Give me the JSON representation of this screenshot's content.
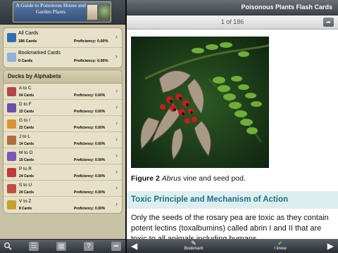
{
  "sidebar": {
    "logo_text": "A Guide to Poisonous House and Garden Plants",
    "summary": [
      {
        "title": "All Cards",
        "count": "186 Cards",
        "proficiency": "Proficiency: 0.00%",
        "color": "#2f6fb0"
      },
      {
        "title": "Bookmarked Cards",
        "count": "0 Cards",
        "proficiency": "Proficiency: 0.00%",
        "color": "#8fb3d8"
      }
    ],
    "decks_header": "Decks by Alphabets",
    "decks": [
      {
        "title": "A to C",
        "count": "64 Cards",
        "proficiency": "Proficiency: 0.00%",
        "color": "#b2454a"
      },
      {
        "title": "D to F",
        "count": "15 Cards",
        "proficiency": "Proficiency: 0.00%",
        "color": "#6b4fa8"
      },
      {
        "title": "G to I",
        "count": "22 Cards",
        "proficiency": "Proficiency: 0.00%",
        "color": "#d99430"
      },
      {
        "title": "J to L",
        "count": "14 Cards",
        "proficiency": "Proficiency: 0.00%",
        "color": "#b36a40"
      },
      {
        "title": "M to O",
        "count": "15 Cards",
        "proficiency": "Proficiency: 0.00%",
        "color": "#7a58b8"
      },
      {
        "title": "P to R",
        "count": "24 Cards",
        "proficiency": "Proficiency: 0.00%",
        "color": "#c03a3a"
      },
      {
        "title": "S to U",
        "count": "24 Cards",
        "proficiency": "Proficiency: 0.00%",
        "color": "#c05040"
      },
      {
        "title": "V to Z",
        "count": "8 Cards",
        "proficiency": "Proficiency: 0.00%",
        "color": "#c7a030"
      }
    ],
    "toolbar_icons": [
      "search-icon",
      "list-icon",
      "cards-icon",
      "help-icon",
      "share-icon"
    ]
  },
  "main": {
    "app_title": "Poisonous Plants Flash Cards",
    "position": "1 of 186",
    "figure_label": "Figure 2",
    "figure_species": "Abrus",
    "figure_rest": " vine and seed pod.",
    "section_title": "Toxic Principle and Mechanism of Action",
    "body": "Only the seeds of the rosary pea are toxic as they contain potent lectins (toxalbumins) called abrin I and II that are toxic to all animals including humans"
  },
  "bottom": {
    "bookmark_label": "Bookmark",
    "iknow_label": "I know"
  }
}
